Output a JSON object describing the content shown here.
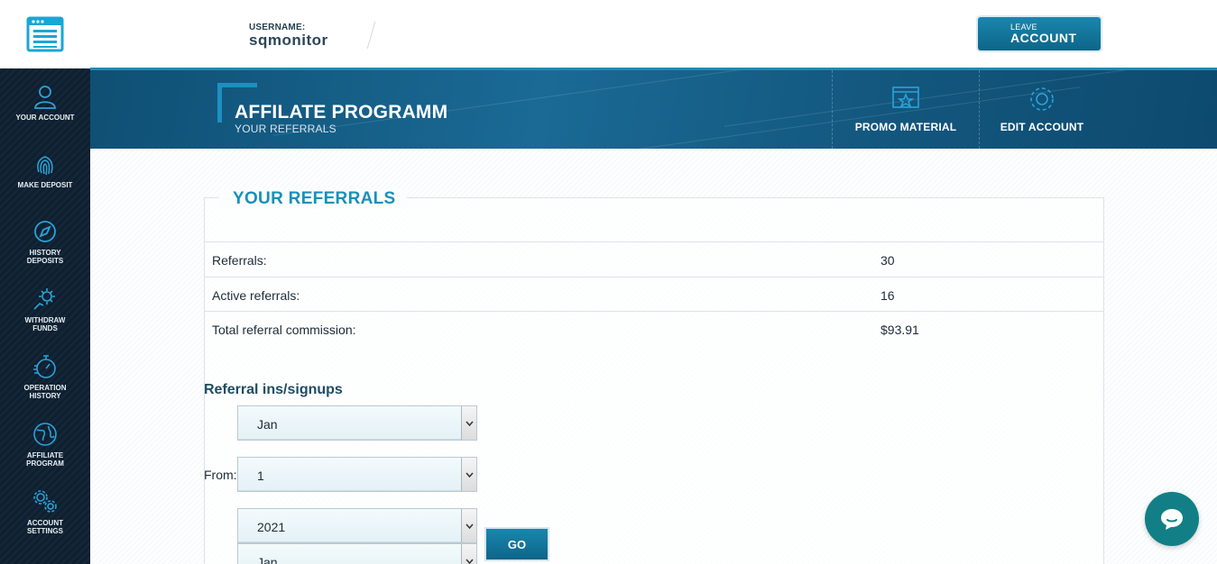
{
  "header": {
    "username_label": "USERNAME:",
    "username": "sqmonitor",
    "leave_small": "LEAVE",
    "leave_big": "ACCOUNT"
  },
  "sidebar": {
    "items": [
      {
        "label": "YOUR ACCOUNT",
        "icon": "user-icon"
      },
      {
        "label": "MAKE DEPOSIT",
        "icon": "fingerprint-icon"
      },
      {
        "label": "HISTORY DEPOSITS",
        "icon": "compass-icon"
      },
      {
        "label": "WITHDRAW FUNDS",
        "icon": "gear-hand-icon"
      },
      {
        "label": "OPERATION HISTORY",
        "icon": "stopwatch-icon"
      },
      {
        "label": "AFFILIATE PROGRAM",
        "icon": "globe-icon"
      },
      {
        "label": "ACCOUNT SETTINGS",
        "icon": "gears-icon"
      }
    ]
  },
  "banner": {
    "title": "AFFILATE PROGRAMM",
    "subtitle": "YOUR REFERRALS",
    "links": [
      {
        "label": "PROMO MATERIAL",
        "icon": "promo-icon"
      },
      {
        "label": "EDIT ACCOUNT",
        "icon": "gear-icon"
      }
    ]
  },
  "referrals": {
    "title": "YOUR REFERRALS",
    "rows": [
      {
        "label": "Referrals:",
        "value": "30"
      },
      {
        "label": "Active referrals:",
        "value": "16"
      },
      {
        "label": "Total referral commission:",
        "value": "$93.91"
      }
    ]
  },
  "signups": {
    "title": "Referral ins/signups",
    "from_label": "From:",
    "from_month": "Jan",
    "from_day": "1",
    "from_year": "2021",
    "to_month": "Jan",
    "go_label": "GO"
  },
  "colors": {
    "accent": "#1990b9",
    "banner": "#13577e",
    "sidebar": "#0d1f30",
    "chat": "#127f86"
  }
}
